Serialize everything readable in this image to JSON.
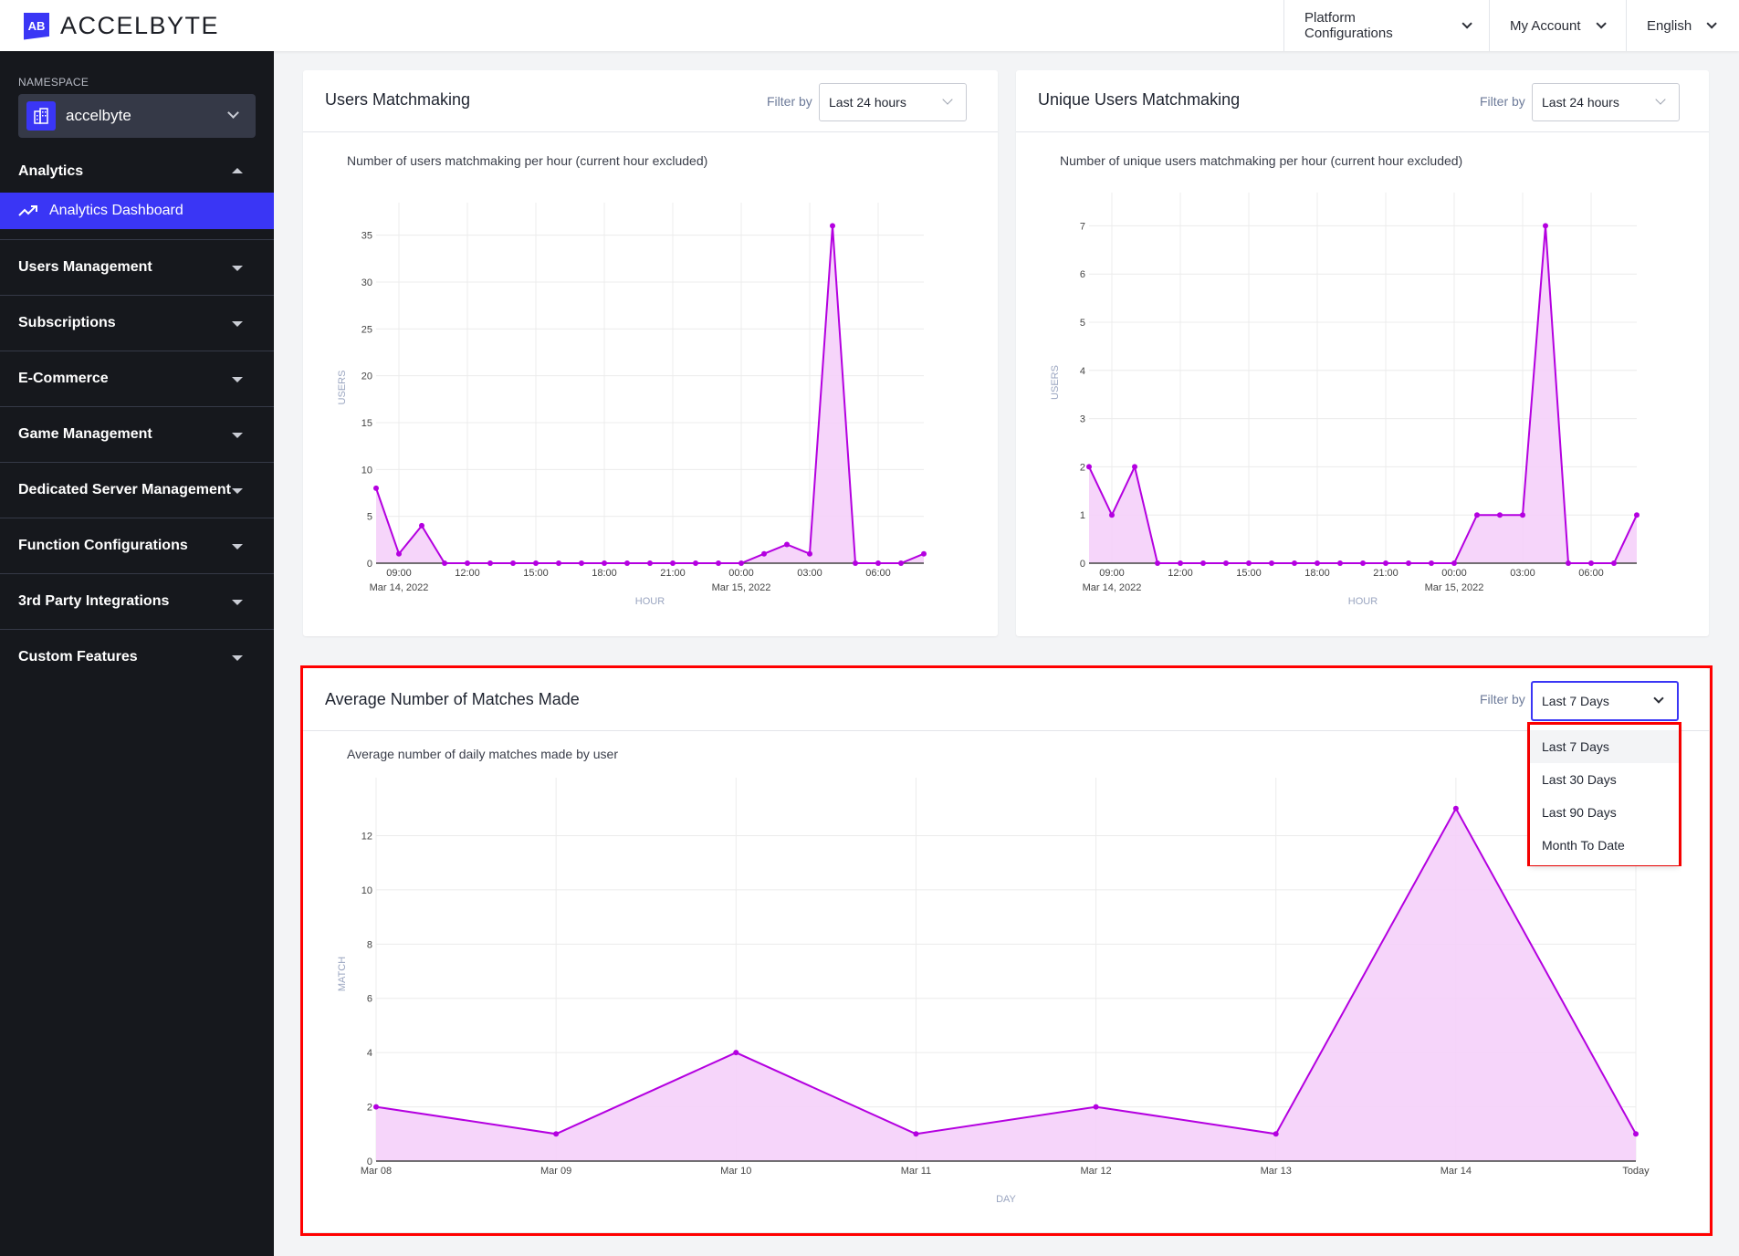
{
  "header": {
    "brand": "ACCELBYTE",
    "logo_mark": "AB",
    "nav": [
      {
        "label": "Platform Configurations",
        "icon": "chevron-down-icon"
      },
      {
        "label": "My Account",
        "icon": "chevron-down-icon"
      },
      {
        "label": "English",
        "icon": "chevron-down-icon"
      }
    ]
  },
  "sidebar": {
    "namespace_label": "NAMESPACE",
    "namespace_value": "accelbyte",
    "namespace_icon": "building-icon",
    "analytics_section": "Analytics",
    "active_item": {
      "label": "Analytics Dashboard",
      "icon": "trending-up-icon"
    },
    "items": [
      {
        "label": "Users Management"
      },
      {
        "label": "Subscriptions"
      },
      {
        "label": "E-Commerce"
      },
      {
        "label": "Game Management"
      },
      {
        "label": "Dedicated Server Management"
      },
      {
        "label": "Function Configurations"
      },
      {
        "label": "3rd Party Integrations"
      },
      {
        "label": "Custom Features"
      }
    ]
  },
  "cards": {
    "users_matchmaking": {
      "title": "Users Matchmaking",
      "filter_label": "Filter by",
      "filter_value": "Last 24 hours",
      "subtitle": "Number of users matchmaking per hour (current hour excluded)"
    },
    "unique_users_matchmaking": {
      "title": "Unique Users Matchmaking",
      "filter_label": "Filter by",
      "filter_value": "Last 24 hours",
      "subtitle": "Number of unique users matchmaking per hour (current hour excluded)"
    },
    "avg_matches": {
      "title": "Average Number of Matches Made",
      "filter_label": "Filter by",
      "filter_value": "Last 7 Days",
      "subtitle": "Average number of daily matches made by user",
      "dropdown_options": [
        "Last 7 Days",
        "Last 30 Days",
        "Last 90 Days",
        "Month To Date"
      ],
      "dropdown_selected_index": 0
    }
  },
  "colors": {
    "accent": "#3a36f5",
    "series_line": "#b400e0",
    "series_fill": "#f5d0fa",
    "highlight": "#ff0000",
    "sidebar_bg": "#16181d"
  },
  "chart_data": [
    {
      "type": "area",
      "title": "Number of users matchmaking per hour (current hour excluded)",
      "xlabel": "HOUR",
      "ylabel": "USERS",
      "x": [
        "08:00",
        "09:00",
        "10:00",
        "11:00",
        "12:00",
        "13:00",
        "14:00",
        "15:00",
        "16:00",
        "17:00",
        "18:00",
        "19:00",
        "20:00",
        "21:00",
        "22:00",
        "23:00",
        "00:00",
        "01:00",
        "02:00",
        "03:00",
        "04:00",
        "05:00",
        "06:00",
        "07:00",
        "08:00"
      ],
      "x_ticks": [
        {
          "label": "09:00",
          "sub": "Mar 14, 2022",
          "index": 1
        },
        {
          "label": "12:00",
          "sub": "",
          "index": 4
        },
        {
          "label": "15:00",
          "sub": "",
          "index": 7
        },
        {
          "label": "18:00",
          "sub": "",
          "index": 10
        },
        {
          "label": "21:00",
          "sub": "",
          "index": 13
        },
        {
          "label": "00:00",
          "sub": "Mar 15, 2022",
          "index": 16
        },
        {
          "label": "03:00",
          "sub": "",
          "index": 19
        },
        {
          "label": "06:00",
          "sub": "",
          "index": 22
        }
      ],
      "series": [
        {
          "name": "Users",
          "values": [
            8,
            1,
            4,
            0,
            0,
            0,
            0,
            0,
            0,
            0,
            0,
            0,
            0,
            0,
            0,
            0,
            0,
            1,
            2,
            1,
            36,
            0,
            0,
            0,
            1
          ]
        }
      ],
      "y_ticks": [
        0,
        5,
        10,
        15,
        20,
        25,
        30,
        35
      ],
      "ylim": [
        0,
        37.5
      ],
      "grid": true
    },
    {
      "type": "area",
      "title": "Number of unique users matchmaking per hour (current hour excluded)",
      "xlabel": "HOUR",
      "ylabel": "USERS",
      "x": [
        "08:00",
        "09:00",
        "10:00",
        "11:00",
        "12:00",
        "13:00",
        "14:00",
        "15:00",
        "16:00",
        "17:00",
        "18:00",
        "19:00",
        "20:00",
        "21:00",
        "22:00",
        "23:00",
        "00:00",
        "01:00",
        "02:00",
        "03:00",
        "04:00",
        "05:00",
        "06:00",
        "07:00",
        "08:00"
      ],
      "x_ticks": [
        {
          "label": "09:00",
          "sub": "Mar 14, 2022",
          "index": 1
        },
        {
          "label": "12:00",
          "sub": "",
          "index": 4
        },
        {
          "label": "15:00",
          "sub": "",
          "index": 7
        },
        {
          "label": "18:00",
          "sub": "",
          "index": 10
        },
        {
          "label": "21:00",
          "sub": "",
          "index": 13
        },
        {
          "label": "00:00",
          "sub": "Mar 15, 2022",
          "index": 16
        },
        {
          "label": "03:00",
          "sub": "",
          "index": 19
        },
        {
          "label": "06:00",
          "sub": "",
          "index": 22
        }
      ],
      "series": [
        {
          "name": "Unique Users",
          "values": [
            2,
            1,
            2,
            0,
            0,
            0,
            0,
            0,
            0,
            0,
            0,
            0,
            0,
            0,
            0,
            0,
            0,
            1,
            1,
            1,
            7,
            0,
            0,
            0,
            1
          ]
        }
      ],
      "y_ticks": [
        0,
        1,
        2,
        3,
        4,
        5,
        6,
        7
      ],
      "ylim": [
        0,
        7.5
      ],
      "grid": true
    },
    {
      "type": "area",
      "title": "Average number of daily matches made by user",
      "xlabel": "DAY",
      "ylabel": "MATCH",
      "x": [
        "Mar 08",
        "Mar 09",
        "Mar 10",
        "Mar 11",
        "Mar 12",
        "Mar 13",
        "Mar 14",
        "Today"
      ],
      "x_ticks": [
        {
          "label": "Mar 08",
          "sub": "",
          "index": 0
        },
        {
          "label": "Mar 09",
          "sub": "",
          "index": 1
        },
        {
          "label": "Mar 10",
          "sub": "",
          "index": 2
        },
        {
          "label": "Mar 11",
          "sub": "",
          "index": 3
        },
        {
          "label": "Mar 12",
          "sub": "",
          "index": 4
        },
        {
          "label": "Mar 13",
          "sub": "",
          "index": 5
        },
        {
          "label": "Mar 14",
          "sub": "",
          "index": 6
        },
        {
          "label": "Today",
          "sub": "",
          "index": 7
        }
      ],
      "series": [
        {
          "name": "Matches",
          "values": [
            2,
            1,
            4,
            1,
            2,
            1,
            13,
            1
          ]
        }
      ],
      "y_ticks": [
        0,
        2,
        4,
        6,
        8,
        10,
        12
      ],
      "ylim": [
        0,
        13.8
      ],
      "grid": true
    }
  ]
}
